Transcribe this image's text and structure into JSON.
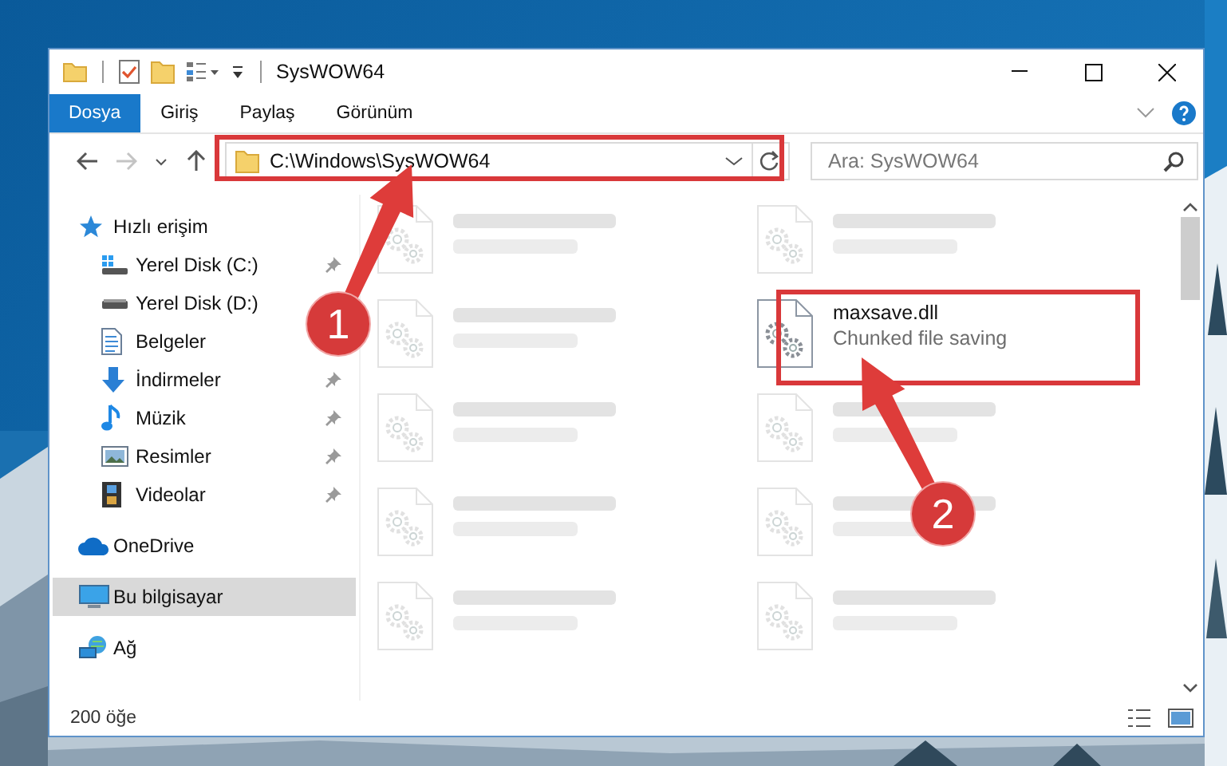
{
  "window": {
    "title": "SysWOW64"
  },
  "ribbon_tabs": [
    {
      "label": "Dosya",
      "selected": true
    },
    {
      "label": "Giriş",
      "selected": false
    },
    {
      "label": "Paylaş",
      "selected": false
    },
    {
      "label": "Görünüm",
      "selected": false
    }
  ],
  "address_bar": {
    "path": "C:\\Windows\\SysWOW64"
  },
  "search": {
    "placeholder": "Ara: SysWOW64"
  },
  "sidebar": {
    "items": [
      {
        "label": "Hızlı erişim",
        "kind": "star",
        "selected": false,
        "children": [
          {
            "label": "Yerel Disk (C:)",
            "kind": "drive-c",
            "pinned": true
          },
          {
            "label": "Yerel Disk (D:)",
            "kind": "drive",
            "pinned": false
          },
          {
            "label": "Belgeler",
            "kind": "document",
            "pinned": false
          },
          {
            "label": "İndirmeler",
            "kind": "download",
            "pinned": true
          },
          {
            "label": "Müzik",
            "kind": "music",
            "pinned": true
          },
          {
            "label": "Resimler",
            "pinned": true
          },
          {
            "label": "Videolar",
            "kind": "film",
            "pinned": true
          }
        ]
      },
      {
        "label": "OneDrive",
        "kind": "cloud",
        "selected": false
      },
      {
        "label": "Bu bilgisayar",
        "kind": "computer",
        "selected": true
      },
      {
        "label": "Ağ",
        "kind": "network",
        "selected": false
      }
    ]
  },
  "files": [
    {
      "kind": "blurred"
    },
    {
      "kind": "blurred"
    },
    {
      "kind": "blurred"
    },
    {
      "kind": "file",
      "name": "maxsave.dll",
      "description": "Chunked file saving"
    },
    {
      "kind": "blurred"
    },
    {
      "kind": "blurred"
    },
    {
      "kind": "blurred"
    },
    {
      "kind": "blurred"
    },
    {
      "kind": "blurred"
    },
    {
      "kind": "blurred"
    }
  ],
  "status_bar": {
    "item_count": "200 öğe"
  },
  "callouts": [
    {
      "number": "1"
    },
    {
      "number": "2"
    }
  ]
}
